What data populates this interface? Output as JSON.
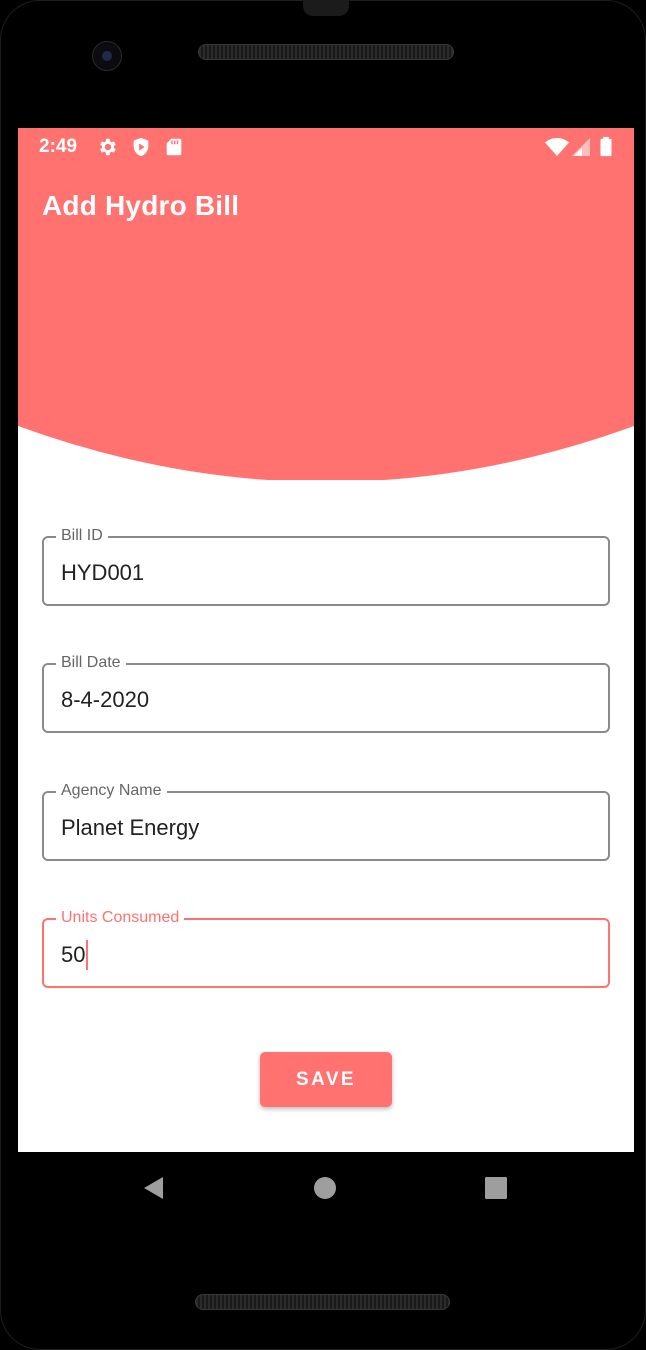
{
  "status_bar": {
    "time": "2:49",
    "icons": [
      "gear-icon",
      "shield-play-icon",
      "sd-card-icon",
      "wifi-icon",
      "signal-icon",
      "battery-icon"
    ]
  },
  "app_bar": {
    "title": "Add Hydro Bill"
  },
  "form": {
    "bill_id": {
      "label": "Bill ID",
      "value": "HYD001"
    },
    "bill_date": {
      "label": "Bill Date",
      "value": "8-4-2020"
    },
    "agency_name": {
      "label": "Agency Name",
      "value": "Planet Energy"
    },
    "units_consumed": {
      "label": "Units Consumed",
      "value": "50"
    },
    "save_label": "SAVE"
  },
  "nav_bar": {
    "icons": [
      "back-icon",
      "home-icon",
      "recents-icon"
    ]
  },
  "colors": {
    "accent": "#ff7270",
    "background": "#ffffff",
    "outline": "#8a8a8a"
  }
}
